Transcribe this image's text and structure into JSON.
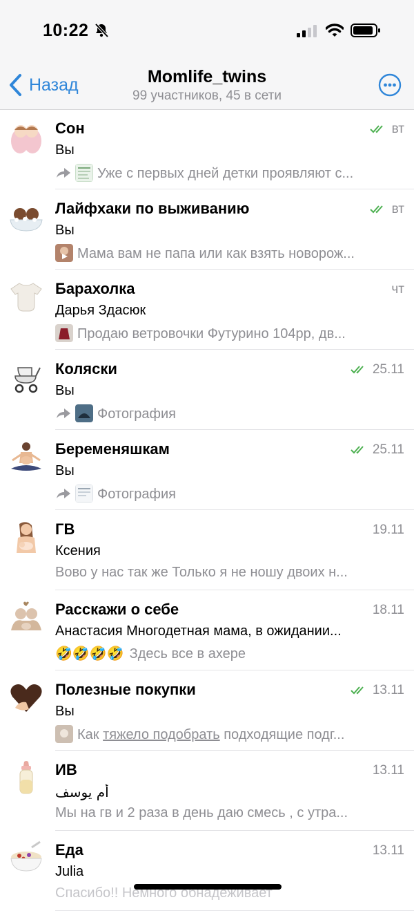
{
  "status_bar": {
    "time": "10:22"
  },
  "header": {
    "back_label": "Назад",
    "title": "Momlife_twins",
    "subtitle": "99 участников, 45 в сети"
  },
  "colors": {
    "accent": "#2f86d9",
    "read_check": "#4cb050",
    "secondary_text": "#8e8e93"
  },
  "topics": [
    {
      "title": "Сон",
      "time": "вт",
      "read": true,
      "sender": "Вы",
      "forwarded": true,
      "thumb_icon": "document-thumb",
      "preview": "Уже с первых дней детки проявляют с...",
      "avatar_icon": "twins-babies-icon"
    },
    {
      "title": "Лайфхаки по выживанию",
      "time": "вт",
      "read": true,
      "sender": "Вы",
      "forwarded": false,
      "thumb_icon": "video-thumb",
      "preview": "Мама вам не папа или как взять новорож...",
      "avatar_icon": "twins-bath-icon"
    },
    {
      "title": "Барахолка",
      "time": "чт",
      "read": false,
      "sender": "Дарья Здасюк",
      "forwarded": false,
      "thumb_icon": "photo-thumb",
      "preview": "Продаю ветровочки Футурино 104рр, дв...",
      "avatar_icon": "onesie-icon"
    },
    {
      "title": "Коляски",
      "time": "25.11",
      "read": true,
      "sender": "Вы",
      "forwarded": true,
      "thumb_icon": "photo-thumb",
      "preview": "Фотография",
      "avatar_icon": "stroller-icon"
    },
    {
      "title": "Беременяшкам",
      "time": "25.11",
      "read": true,
      "sender": "Вы",
      "forwarded": true,
      "thumb_icon": "document-thumb",
      "preview": "Фотография",
      "avatar_icon": "pregnant-yoga-icon"
    },
    {
      "title": "ГВ",
      "time": "19.11",
      "read": false,
      "sender": "Ксения",
      "forwarded": false,
      "thumb_icon": "",
      "preview": "Вово у нас так же Только я не ношу двоих н...",
      "avatar_icon": "breastfeeding-icon"
    },
    {
      "title": "Расскажи о себе",
      "time": "18.11",
      "read": false,
      "sender": "Анастасия Многодетная мама, в ожидании...",
      "forwarded": false,
      "thumb_icon": "",
      "emoji_prefix": "🤣🤣🤣🤣",
      "preview": "Здесь все в ахере",
      "avatar_icon": "family-hug-icon"
    },
    {
      "title": "Полезные покупки",
      "time": "13.11",
      "read": true,
      "sender": "Вы",
      "forwarded": false,
      "thumb_icon": "photo-thumb",
      "preview_before": "Как ",
      "preview_link": "тяжело подобрать",
      "preview_after": " подходящие подг...",
      "avatar_icon": "heart-hand-icon"
    },
    {
      "title": "ИВ",
      "time": "13.11",
      "read": false,
      "sender": "أم يوسف",
      "forwarded": false,
      "thumb_icon": "",
      "preview": "Мы на гв и 2 раза в день даю смесь , с утра...",
      "avatar_icon": "baby-bottle-icon"
    },
    {
      "title": "Еда",
      "time": "13.11",
      "read": false,
      "sender": "Julia",
      "forwarded": false,
      "thumb_icon": "",
      "preview": "Спасибо!! Немного обнадеживает",
      "avatar_icon": "porridge-bowl-icon"
    }
  ]
}
